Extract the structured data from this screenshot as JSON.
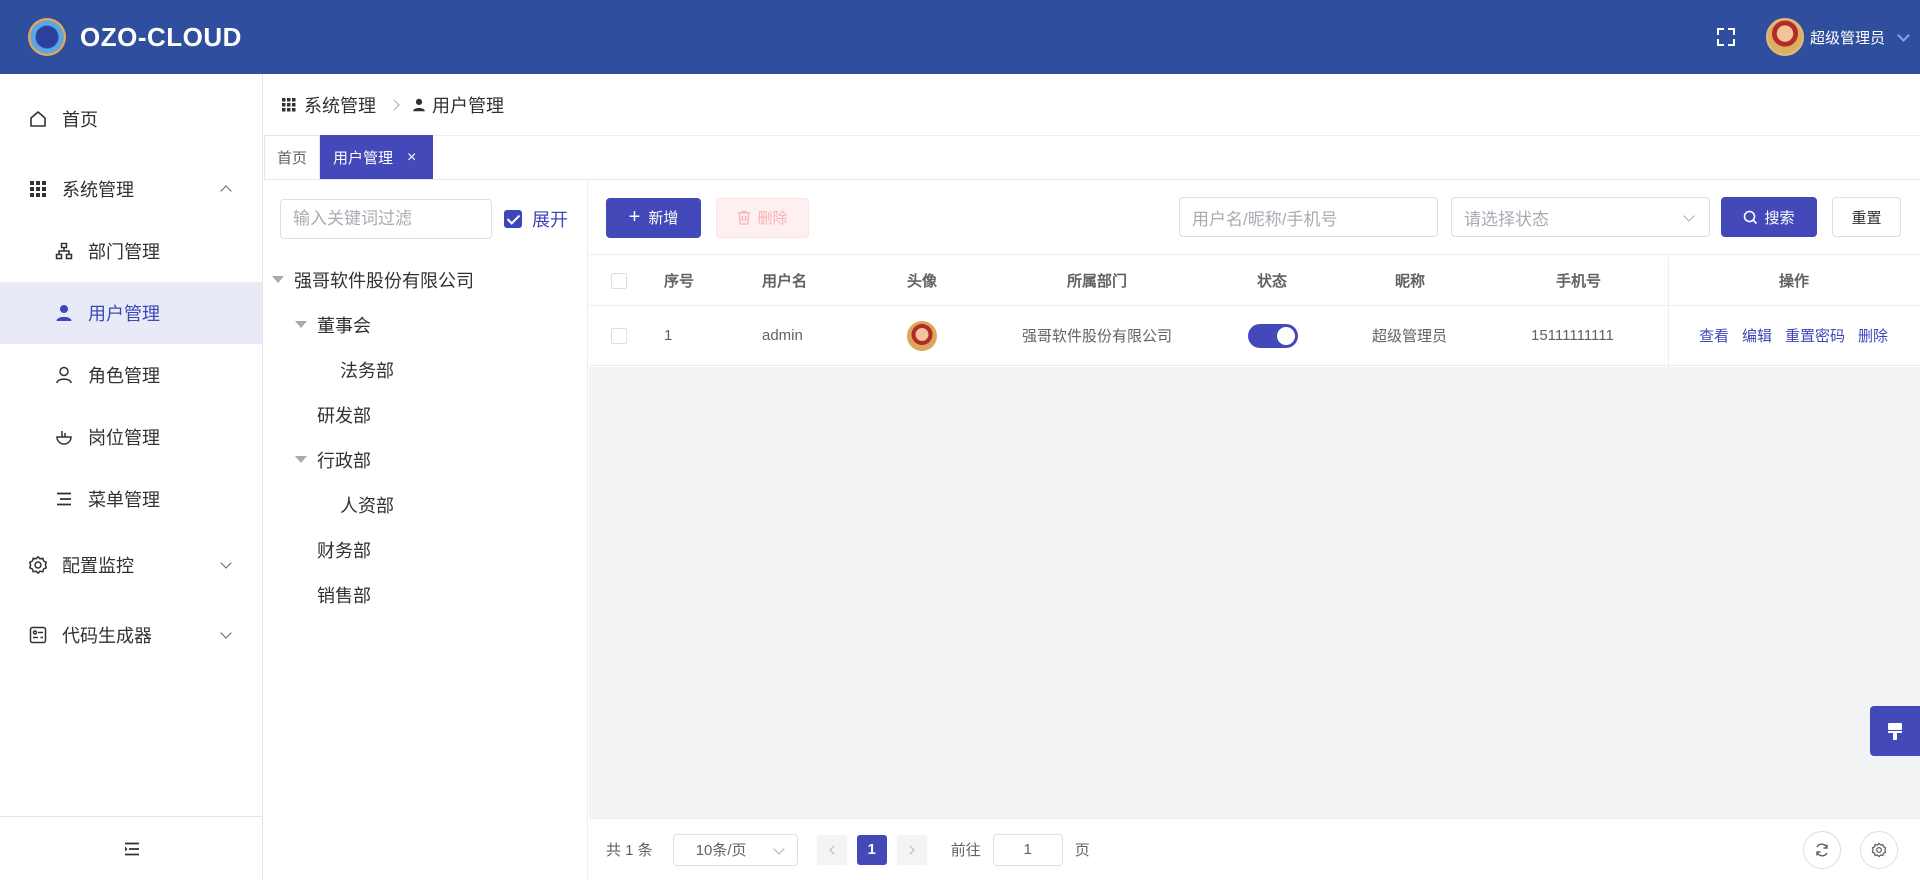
{
  "app": {
    "title": "OZO-CLOUD"
  },
  "header": {
    "user_name": "超级管理员"
  },
  "sidebar": {
    "items": [
      {
        "label": "首页"
      },
      {
        "label": "系统管理"
      },
      {
        "label": "部门管理"
      },
      {
        "label": "用户管理"
      },
      {
        "label": "角色管理"
      },
      {
        "label": "岗位管理"
      },
      {
        "label": "菜单管理"
      },
      {
        "label": "配置监控"
      },
      {
        "label": "代码生成器"
      }
    ]
  },
  "breadcrumb": {
    "parent": "系统管理",
    "current": "用户管理"
  },
  "tabs": [
    {
      "label": "首页"
    },
    {
      "label": "用户管理",
      "close": "×"
    }
  ],
  "tree": {
    "filter_placeholder": "输入关键词过滤",
    "expand_label": "展开",
    "nodes": [
      {
        "label": "强哥软件股份有限公司"
      },
      {
        "label": "董事会"
      },
      {
        "label": "法务部"
      },
      {
        "label": "研发部"
      },
      {
        "label": "行政部"
      },
      {
        "label": "人资部"
      },
      {
        "label": "财务部"
      },
      {
        "label": "销售部"
      }
    ]
  },
  "toolbar": {
    "add_label": "新增",
    "delete_label": "删除",
    "search_placeholder": "用户名/昵称/手机号",
    "status_placeholder": "请选择状态",
    "search_label": "搜索",
    "reset_label": "重置"
  },
  "table": {
    "headers": [
      "序号",
      "用户名",
      "头像",
      "所属部门",
      "状态",
      "昵称",
      "手机号",
      "操作"
    ],
    "rows": [
      {
        "index": "1",
        "username": "admin",
        "department": "强哥软件股份有限公司",
        "status_on": true,
        "nickname": "超级管理员",
        "phone": "15111111111"
      }
    ],
    "actions": [
      "查看",
      "编辑",
      "重置密码",
      "删除"
    ]
  },
  "pagination": {
    "total_text": "共 1 条",
    "page_size": "10条/页",
    "current_page": "1",
    "goto_label": "前往",
    "goto_value": "1",
    "page_suffix": "页"
  },
  "colors": {
    "header_bg": "#2f4f9e",
    "primary": "#4349b9",
    "active_menu_bg": "#e8eaf7"
  },
  "icons": [
    "home-icon",
    "grid-icon",
    "org-icon",
    "user-filled-icon",
    "user-outline-icon",
    "post-icon",
    "menu-list-icon",
    "gear-icon",
    "code-icon",
    "fullscreen-icon",
    "paint-brush-icon",
    "refresh-icon",
    "settings-icon"
  ]
}
